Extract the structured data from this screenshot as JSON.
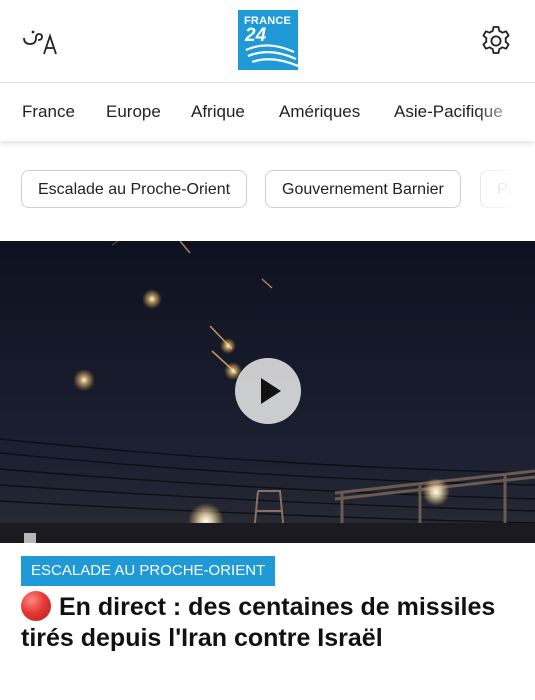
{
  "header": {
    "language_icon": "language-translate-icon",
    "logo": {
      "line1": "FRANCE",
      "line2": "24",
      "color": "#1f9ad6"
    },
    "settings_icon": "gear-icon"
  },
  "nav": {
    "items": [
      {
        "label": "France"
      },
      {
        "label": "Europe"
      },
      {
        "label": "Afrique"
      },
      {
        "label": "Amériques"
      },
      {
        "label": "Asie-Pacifique"
      }
    ]
  },
  "chips": {
    "items": [
      {
        "label": "Escalade au Proche-Orient"
      },
      {
        "label": "Gouvernement Barnier"
      },
      {
        "label": "Pr"
      }
    ]
  },
  "article": {
    "media_icon": "play-icon",
    "category": "ESCALADE AU PROCHE-ORIENT",
    "headline": "En direct : des centaines de missiles tirés depuis l'Iran contre Israël",
    "live_color": "#e53935"
  }
}
